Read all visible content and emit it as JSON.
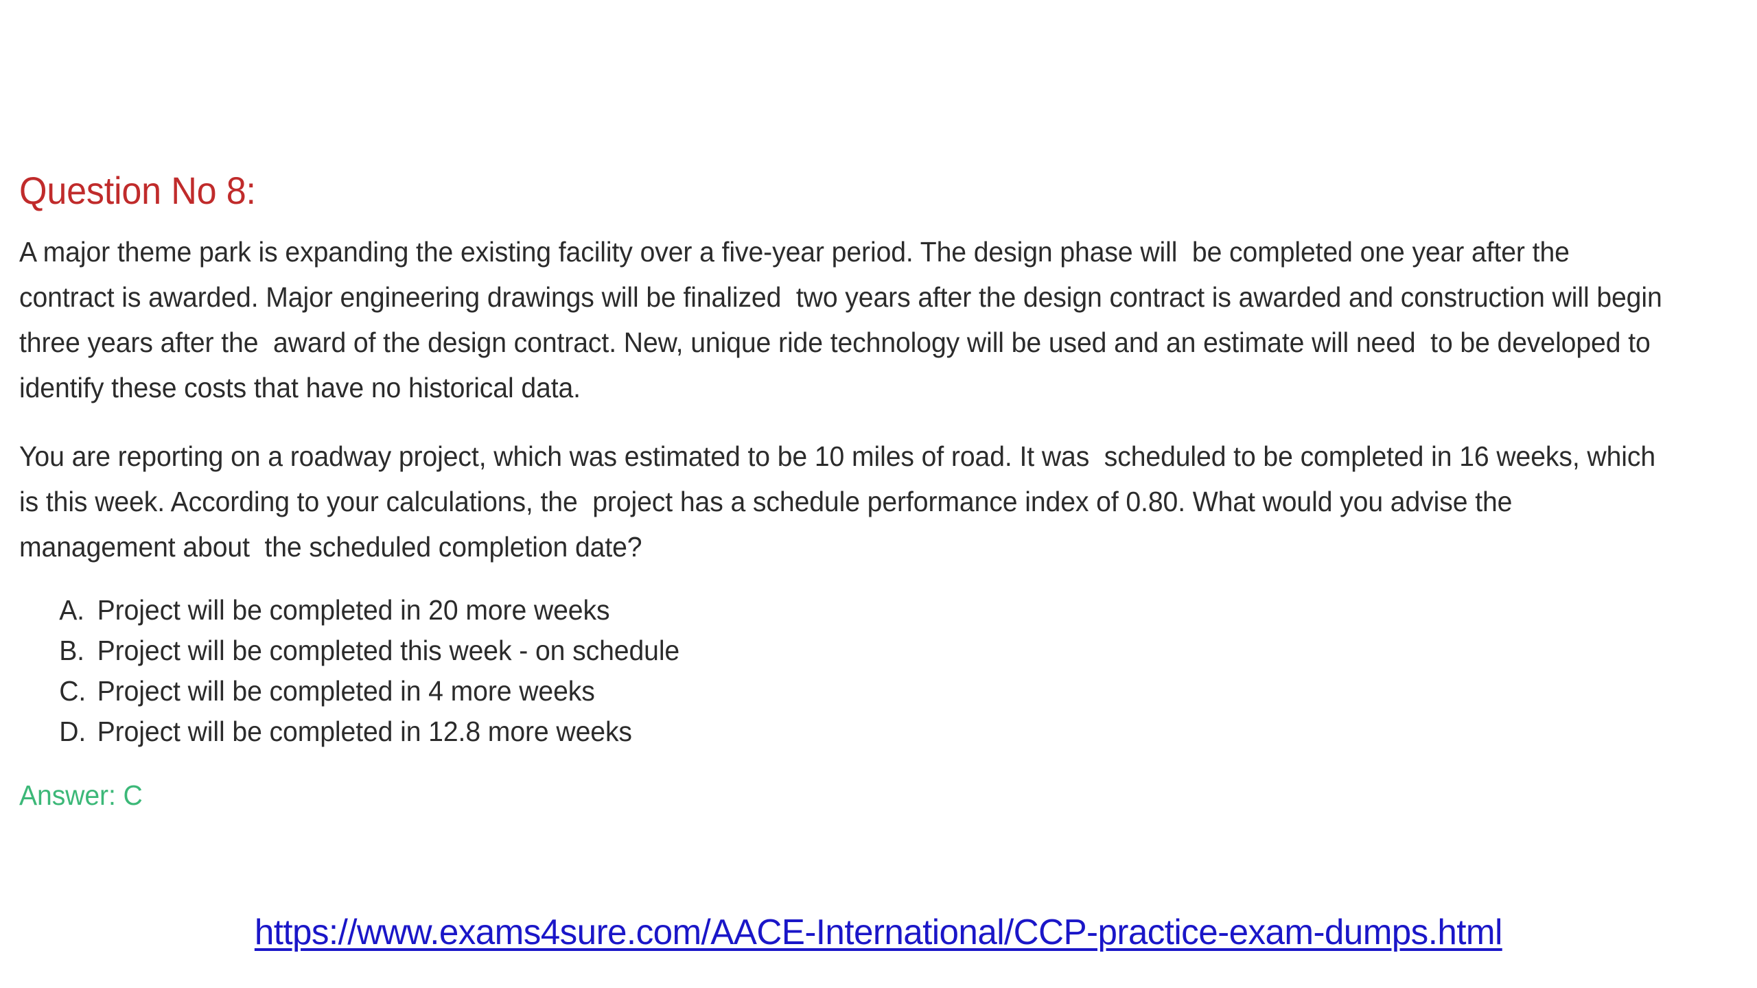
{
  "page": {
    "background_color": "#ffffff",
    "heading_color": "#c02b2b",
    "body_color": "#2b2b2b",
    "answer_color": "#3cb878",
    "link_color": "#1a16c8"
  },
  "question": {
    "heading": "Question No 8:",
    "paragraph_1": "A major theme park is expanding the existing facility over a five-year period. The design phase will  be completed one year after the contract is awarded. Major engineering drawings will be finalized  two years after the design contract is awarded and construction will begin three years after the  award of the design contract. New, unique ride technology will be used and an estimate will need  to be developed to identify these costs that have no historical data.",
    "paragraph_2": "You are reporting on a roadway project, which was estimated to be 10 miles of road. It was  scheduled to be completed in 16 weeks, which is this week. According to your calculations, the  project has a schedule performance index of 0.80. What would you advise the management about  the scheduled completion date?"
  },
  "options": [
    {
      "letter": "A.",
      "text": "Project will be completed in 20 more weeks"
    },
    {
      "letter": "B.",
      "text": "Project will be completed this week - on schedule"
    },
    {
      "letter": "C.",
      "text": "Project will be completed in 4 more weeks"
    },
    {
      "letter": "D.",
      "text": "Project will be completed in 12.8 more weeks"
    }
  ],
  "answer": {
    "label": "Answer: C"
  },
  "footer": {
    "url_text": "https://www.exams4sure.com/AACE-International/CCP-practice-exam-dumps.html"
  }
}
